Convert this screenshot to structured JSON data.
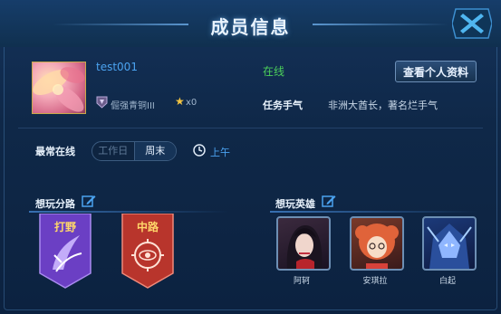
{
  "dialog": {
    "title": "成员信息"
  },
  "member": {
    "username": "test001",
    "rank": "倔强青铜III",
    "stars": "x0",
    "status": "在线",
    "view_button": "查看个人资料",
    "task_label": "任务手气",
    "task_value": "非洲大酋长，著名烂手气"
  },
  "online_time": {
    "label": "最常在线",
    "options": [
      "工作日",
      "周末"
    ],
    "selected": "周末",
    "time": "上午"
  },
  "lanes": {
    "title": "想玩分路",
    "items": [
      {
        "label": "打野",
        "color": "#6b3fc4"
      },
      {
        "label": "中路",
        "color": "#b8352c"
      }
    ]
  },
  "heroes": {
    "title": "想玩英雄",
    "items": [
      {
        "name": "阿轲"
      },
      {
        "name": "安琪拉"
      },
      {
        "name": "白起"
      }
    ]
  },
  "colors": {
    "accent": "#4ba3f0",
    "online": "#4cd05a",
    "gold": "#c9a94b"
  }
}
